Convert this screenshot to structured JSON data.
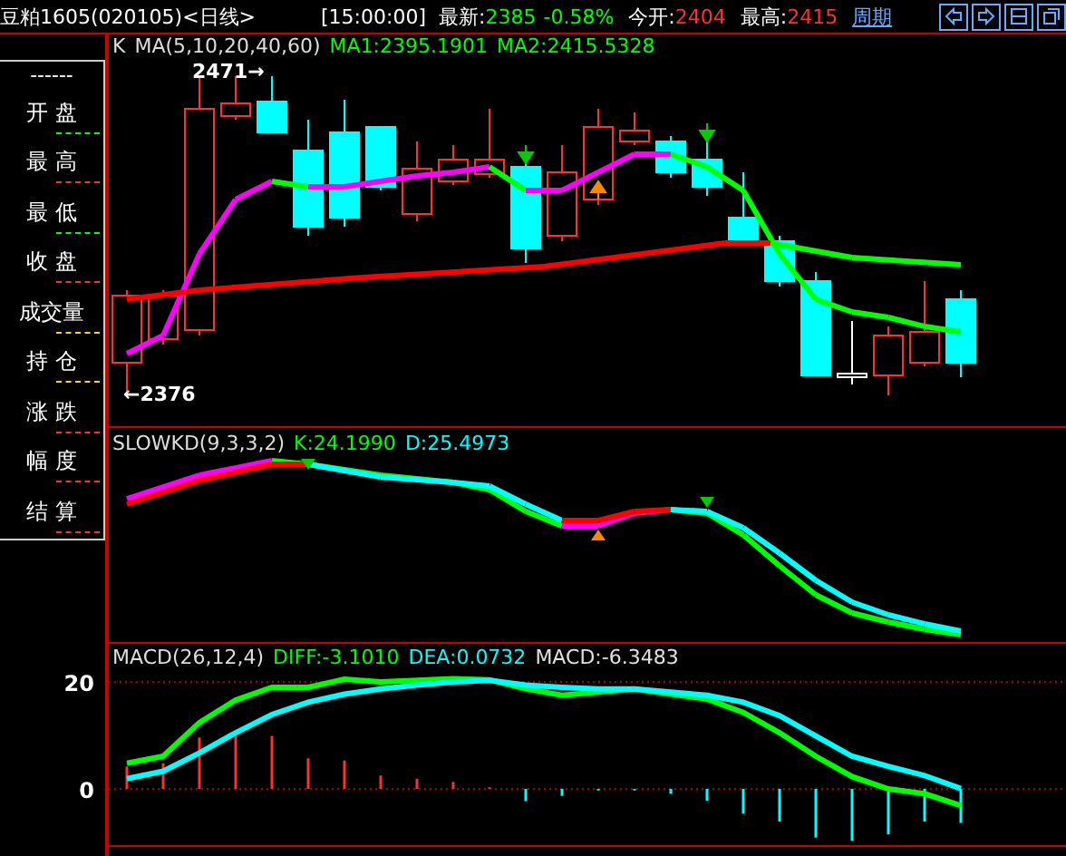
{
  "header": {
    "title": "豆粕1605(020105)<日线>",
    "time": "[15:00:00]",
    "quotes": [
      {
        "label": "最新:",
        "values": [
          "2385",
          "-0.58%"
        ],
        "color": "#00ff00"
      },
      {
        "label": "今开:",
        "values": [
          "2404"
        ],
        "color": "#ff3030"
      },
      {
        "label": "最高:",
        "values": [
          "2415"
        ],
        "color": "#ff3030"
      }
    ],
    "period_link": "周期"
  },
  "left_panel": {
    "heading": "------",
    "items": [
      {
        "label": "开 盘",
        "color": "#00ff00"
      },
      {
        "label": "最 高",
        "color": "#ff3030"
      },
      {
        "label": "最 低",
        "color": "#00ff00"
      },
      {
        "label": "收 盘",
        "color": "#ff3030"
      },
      {
        "label": "成交量",
        "color": "#ffd700"
      },
      {
        "label": "持 仓",
        "color": "#ffd700"
      },
      {
        "label": "涨 跌",
        "color": "#ff3030"
      },
      {
        "label": "幅 度",
        "color": "#ff3030"
      },
      {
        "label": "结 算",
        "color": "#ff3030"
      }
    ]
  },
  "price_panel": {
    "label": "K",
    "indicator": "MA(5,10,20,40,60)",
    "readings": [
      {
        "text": "MA1:2395.1901",
        "color": "#00ff00"
      },
      {
        "text": "MA2:2415.5328",
        "color": "#00ff00"
      }
    ],
    "high_label": "2471→",
    "low_label": "←2376"
  },
  "kd_panel": {
    "indicator": "SLOWKD(9,3,3,2)",
    "readings": [
      {
        "text": "K:24.1990",
        "color": "#00ff00"
      },
      {
        "text": "D:25.4973",
        "color": "#00ffff"
      }
    ]
  },
  "macd_panel": {
    "indicator": "MACD(26,12,4)",
    "readings": [
      {
        "text": "DIFF:-3.1010",
        "color": "#00ff00"
      },
      {
        "text": "DEA:0.0732",
        "color": "#00ffff"
      },
      {
        "text": "MACD:-6.3483",
        "color": "#e0e0e0"
      }
    ],
    "axis_labels": [
      "20",
      "0"
    ]
  }
}
